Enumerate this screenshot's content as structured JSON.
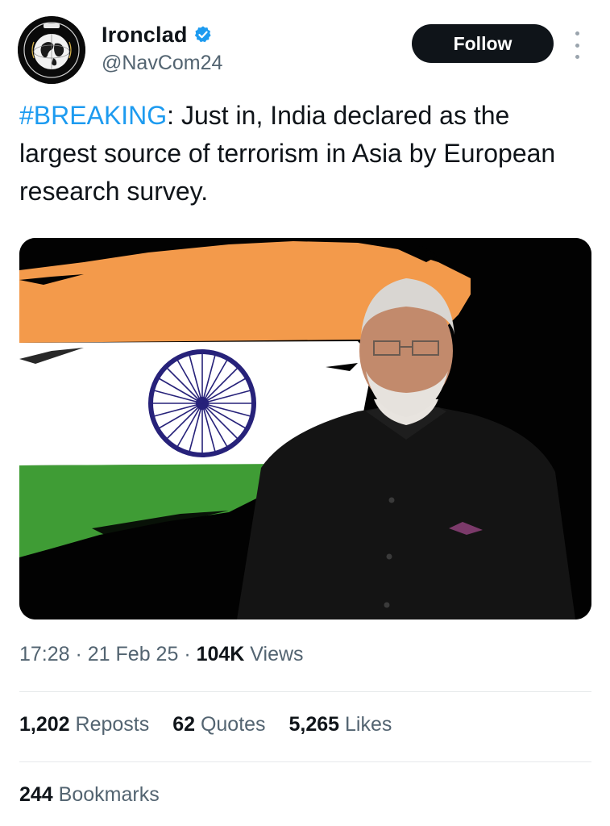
{
  "author": {
    "display_name": "Ironclad",
    "handle": "@NavCom24",
    "verified": true,
    "avatar_icon": "globe-logo-icon",
    "follow_label": "Follow"
  },
  "tweet": {
    "hashtag": "#BREAKING",
    "text": ": Just in, India declared as the largest source of terrorism in Asia by European research survey."
  },
  "media": {
    "description_icon": "indian-flag-portrait-image"
  },
  "meta": {
    "time": "17:28",
    "sep1": " · ",
    "date": "21 Feb 25",
    "sep2": " · ",
    "views_count": "104K",
    "views_label": " Views"
  },
  "stats": {
    "reposts_count": "1,202",
    "reposts_label": " Reposts",
    "quotes_count": "62",
    "quotes_label": " Quotes",
    "likes_count": "5,265",
    "likes_label": " Likes",
    "bookmarks_count": "244",
    "bookmarks_label": " Bookmarks"
  },
  "colors": {
    "link": "#1d9bf0",
    "secondary_text": "#536471",
    "primary_text": "#0f1419",
    "flag_saffron": "#f39a4b",
    "flag_green": "#3f9c35",
    "chakra_navy": "#27227a"
  }
}
